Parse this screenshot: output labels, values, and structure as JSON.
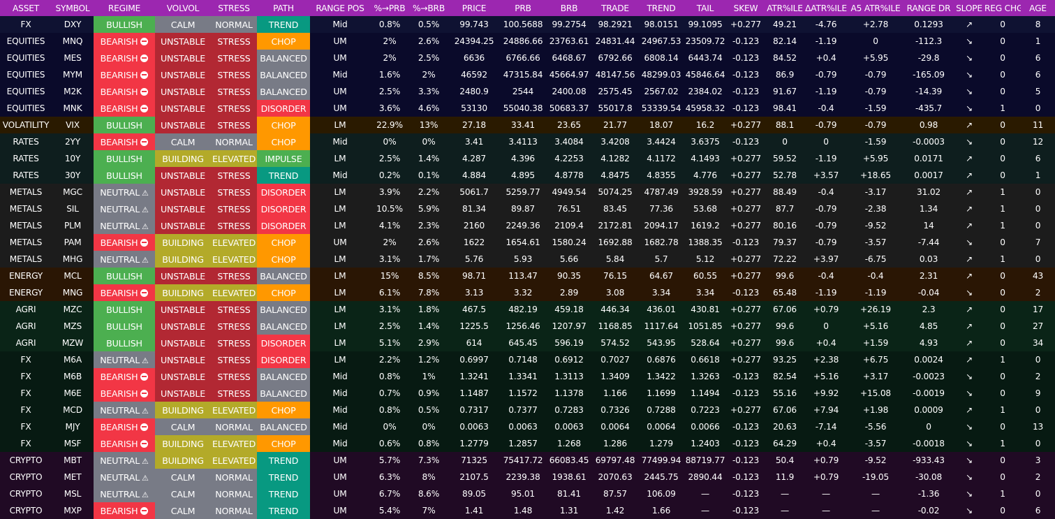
{
  "colors": {
    "header": "#9c27b0",
    "bullish": "#4caf50",
    "bearish": "#f23645",
    "neutral": "#787b86",
    "unstable_stress": "#b22833",
    "building_elevated": "#b3aa29",
    "trend": "#089981",
    "chop": "#ff9800",
    "disorder": "#f23645"
  },
  "columns": [
    "ASSET",
    "SYMBOL",
    "REGIME",
    "VOLVOL",
    "STRESS",
    "PATH",
    "RANGE POS",
    "%→PRB",
    "%→BRB",
    "PRICE",
    "PRB",
    "BRB",
    "TRADE",
    "TREND",
    "TAIL",
    "SKEW",
    "ATR%ILE",
    "ΔATR%ILE",
    "A5 ATR%ILE",
    "RANGE DR",
    "SLOPE",
    "REG CHG",
    "AGE"
  ],
  "rows": [
    {
      "asset": "FX",
      "symbol": "DXY",
      "regime": "BULLISH",
      "regime_icon": "",
      "volvol": "CALM",
      "stress": "NORMAL",
      "path": "TREND",
      "range_pos": "Mid",
      "pct_prb": "0.8%",
      "pct_brb": "0.5%",
      "price": "99.743",
      "prb": "100.5688",
      "brb": "99.2754",
      "trade": "98.2921",
      "trend": "98.0151",
      "tail": "99.1095",
      "skew": "+0.277",
      "atr_ile": "49.21",
      "d_atr_ile": "-4.76",
      "a5_atr_ile": "+2.78",
      "range_dr": "0.1293",
      "slope": "↗",
      "reg_chg": "0",
      "age": "8"
    },
    {
      "asset": "EQUITIES",
      "symbol": "MNQ",
      "regime": "BEARISH",
      "regime_icon": "stop-icon",
      "volvol": "UNSTABLE",
      "stress": "STRESS",
      "path": "CHOP",
      "range_pos": "UM",
      "pct_prb": "2%",
      "pct_brb": "2.6%",
      "price": "24394.25",
      "prb": "24886.66",
      "brb": "23763.61",
      "trade": "24831.44",
      "trend": "24967.53",
      "tail": "23509.72",
      "skew": "-0.123",
      "atr_ile": "82.14",
      "d_atr_ile": "-1.19",
      "a5_atr_ile": "0",
      "range_dr": "-112.3",
      "slope": "↘",
      "reg_chg": "0",
      "age": "1"
    },
    {
      "asset": "EQUITIES",
      "symbol": "MES",
      "regime": "BEARISH",
      "regime_icon": "stop-icon",
      "volvol": "UNSTABLE",
      "stress": "STRESS",
      "path": "BALANCED",
      "range_pos": "UM",
      "pct_prb": "2%",
      "pct_brb": "2.5%",
      "price": "6636",
      "prb": "6766.66",
      "brb": "6468.67",
      "trade": "6792.66",
      "trend": "6808.14",
      "tail": "6443.74",
      "skew": "-0.123",
      "atr_ile": "84.52",
      "d_atr_ile": "+0.4",
      "a5_atr_ile": "+5.95",
      "range_dr": "-29.8",
      "slope": "↘",
      "reg_chg": "0",
      "age": "6"
    },
    {
      "asset": "EQUITIES",
      "symbol": "MYM",
      "regime": "BEARISH",
      "regime_icon": "stop-icon",
      "volvol": "UNSTABLE",
      "stress": "STRESS",
      "path": "BALANCED",
      "range_pos": "Mid",
      "pct_prb": "1.6%",
      "pct_brb": "2%",
      "price": "46592",
      "prb": "47315.84",
      "brb": "45664.97",
      "trade": "48147.56",
      "trend": "48299.03",
      "tail": "45846.64",
      "skew": "-0.123",
      "atr_ile": "86.9",
      "d_atr_ile": "-0.79",
      "a5_atr_ile": "-0.79",
      "range_dr": "-165.09",
      "slope": "↘",
      "reg_chg": "0",
      "age": "6"
    },
    {
      "asset": "EQUITIES",
      "symbol": "M2K",
      "regime": "BEARISH",
      "regime_icon": "stop-icon",
      "volvol": "UNSTABLE",
      "stress": "STRESS",
      "path": "BALANCED",
      "range_pos": "UM",
      "pct_prb": "2.5%",
      "pct_brb": "3.3%",
      "price": "2480.9",
      "prb": "2544",
      "brb": "2400.08",
      "trade": "2575.45",
      "trend": "2567.02",
      "tail": "2384.02",
      "skew": "-0.123",
      "atr_ile": "91.67",
      "d_atr_ile": "-1.19",
      "a5_atr_ile": "-0.79",
      "range_dr": "-14.39",
      "slope": "↘",
      "reg_chg": "0",
      "age": "5"
    },
    {
      "asset": "EQUITIES",
      "symbol": "MNK",
      "regime": "BEARISH",
      "regime_icon": "stop-icon",
      "volvol": "UNSTABLE",
      "stress": "STRESS",
      "path": "DISORDER",
      "range_pos": "UM",
      "pct_prb": "3.6%",
      "pct_brb": "4.6%",
      "price": "53130",
      "prb": "55040.38",
      "brb": "50683.37",
      "trade": "55017.8",
      "trend": "53339.54",
      "tail": "45958.32",
      "skew": "-0.123",
      "atr_ile": "98.41",
      "d_atr_ile": "-0.4",
      "a5_atr_ile": "-1.59",
      "range_dr": "-435.7",
      "slope": "↘",
      "reg_chg": "1",
      "age": "0"
    },
    {
      "asset": "VOLATILITY",
      "symbol": "VIX",
      "regime": "BULLISH",
      "regime_icon": "",
      "volvol": "UNSTABLE",
      "stress": "STRESS",
      "path": "CHOP",
      "range_pos": "LM",
      "pct_prb": "22.9%",
      "pct_brb": "13%",
      "price": "27.18",
      "prb": "33.41",
      "brb": "23.65",
      "trade": "21.77",
      "trend": "18.07",
      "tail": "16.2",
      "skew": "+0.277",
      "atr_ile": "88.1",
      "d_atr_ile": "-0.79",
      "a5_atr_ile": "-0.79",
      "range_dr": "0.98",
      "slope": "↗",
      "reg_chg": "0",
      "age": "11"
    },
    {
      "asset": "RATES",
      "symbol": "2YY",
      "regime": "BEARISH",
      "regime_icon": "stop-icon",
      "volvol": "CALM",
      "stress": "NORMAL",
      "path": "CHOP",
      "range_pos": "Mid",
      "pct_prb": "0%",
      "pct_brb": "0%",
      "price": "3.41",
      "prb": "3.4113",
      "brb": "3.4084",
      "trade": "3.4208",
      "trend": "3.4424",
      "tail": "3.6375",
      "skew": "-0.123",
      "atr_ile": "0",
      "d_atr_ile": "0",
      "a5_atr_ile": "-1.59",
      "range_dr": "-0.0003",
      "slope": "↘",
      "reg_chg": "0",
      "age": "12"
    },
    {
      "asset": "RATES",
      "symbol": "10Y",
      "regime": "BULLISH",
      "regime_icon": "",
      "volvol": "BUILDING",
      "stress": "ELEVATED",
      "path": "IMPULSE",
      "range_pos": "LM",
      "pct_prb": "2.5%",
      "pct_brb": "1.4%",
      "price": "4.287",
      "prb": "4.396",
      "brb": "4.2253",
      "trade": "4.1282",
      "trend": "4.1172",
      "tail": "4.1493",
      "skew": "+0.277",
      "atr_ile": "59.52",
      "d_atr_ile": "-1.19",
      "a5_atr_ile": "+5.95",
      "range_dr": "0.0171",
      "slope": "↗",
      "reg_chg": "0",
      "age": "6"
    },
    {
      "asset": "RATES",
      "symbol": "30Y",
      "regime": "BULLISH",
      "regime_icon": "",
      "volvol": "UNSTABLE",
      "stress": "STRESS",
      "path": "TREND",
      "range_pos": "Mid",
      "pct_prb": "0.2%",
      "pct_brb": "0.1%",
      "price": "4.884",
      "prb": "4.895",
      "brb": "4.8778",
      "trade": "4.8475",
      "trend": "4.8355",
      "tail": "4.776",
      "skew": "+0.277",
      "atr_ile": "52.78",
      "d_atr_ile": "+3.57",
      "a5_atr_ile": "+18.65",
      "range_dr": "0.0017",
      "slope": "↗",
      "reg_chg": "0",
      "age": "1"
    },
    {
      "asset": "METALS",
      "symbol": "MGC",
      "regime": "NEUTRAL",
      "regime_icon": "warn-icon",
      "volvol": "UNSTABLE",
      "stress": "STRESS",
      "path": "DISORDER",
      "range_pos": "LM",
      "pct_prb": "3.9%",
      "pct_brb": "2.2%",
      "price": "5061.7",
      "prb": "5259.77",
      "brb": "4949.54",
      "trade": "5074.25",
      "trend": "4787.49",
      "tail": "3928.59",
      "skew": "+0.277",
      "atr_ile": "88.49",
      "d_atr_ile": "-0.4",
      "a5_atr_ile": "-3.17",
      "range_dr": "31.02",
      "slope": "↗",
      "reg_chg": "1",
      "age": "0"
    },
    {
      "asset": "METALS",
      "symbol": "SIL",
      "regime": "NEUTRAL",
      "regime_icon": "warn-icon",
      "volvol": "UNSTABLE",
      "stress": "STRESS",
      "path": "DISORDER",
      "range_pos": "LM",
      "pct_prb": "10.5%",
      "pct_brb": "5.9%",
      "price": "81.34",
      "prb": "89.87",
      "brb": "76.51",
      "trade": "83.45",
      "trend": "77.36",
      "tail": "53.68",
      "skew": "+0.277",
      "atr_ile": "87.7",
      "d_atr_ile": "-0.79",
      "a5_atr_ile": "-2.38",
      "range_dr": "1.34",
      "slope": "↗",
      "reg_chg": "1",
      "age": "0"
    },
    {
      "asset": "METALS",
      "symbol": "PLM",
      "regime": "NEUTRAL",
      "regime_icon": "warn-icon",
      "volvol": "UNSTABLE",
      "stress": "STRESS",
      "path": "DISORDER",
      "range_pos": "LM",
      "pct_prb": "4.1%",
      "pct_brb": "2.3%",
      "price": "2160",
      "prb": "2249.36",
      "brb": "2109.4",
      "trade": "2172.81",
      "trend": "2094.17",
      "tail": "1619.2",
      "skew": "+0.277",
      "atr_ile": "80.16",
      "d_atr_ile": "-0.79",
      "a5_atr_ile": "-9.52",
      "range_dr": "14",
      "slope": "↗",
      "reg_chg": "1",
      "age": "0"
    },
    {
      "asset": "METALS",
      "symbol": "PAM",
      "regime": "BEARISH",
      "regime_icon": "stop-icon",
      "volvol": "BUILDING",
      "stress": "ELEVATED",
      "path": "CHOP",
      "range_pos": "UM",
      "pct_prb": "2%",
      "pct_brb": "2.6%",
      "price": "1622",
      "prb": "1654.61",
      "brb": "1580.24",
      "trade": "1692.88",
      "trend": "1682.78",
      "tail": "1388.35",
      "skew": "-0.123",
      "atr_ile": "79.37",
      "d_atr_ile": "-0.79",
      "a5_atr_ile": "-3.57",
      "range_dr": "-7.44",
      "slope": "↘",
      "reg_chg": "0",
      "age": "7"
    },
    {
      "asset": "METALS",
      "symbol": "MHG",
      "regime": "NEUTRAL",
      "regime_icon": "warn-icon",
      "volvol": "BUILDING",
      "stress": "ELEVATED",
      "path": "CHOP",
      "range_pos": "LM",
      "pct_prb": "3.1%",
      "pct_brb": "1.7%",
      "price": "5.76",
      "prb": "5.93",
      "brb": "5.66",
      "trade": "5.84",
      "trend": "5.7",
      "tail": "5.12",
      "skew": "+0.277",
      "atr_ile": "72.22",
      "d_atr_ile": "+3.97",
      "a5_atr_ile": "-6.75",
      "range_dr": "0.03",
      "slope": "↗",
      "reg_chg": "1",
      "age": "0"
    },
    {
      "asset": "ENERGY",
      "symbol": "MCL",
      "regime": "BULLISH",
      "regime_icon": "",
      "volvol": "UNSTABLE",
      "stress": "STRESS",
      "path": "BALANCED",
      "range_pos": "LM",
      "pct_prb": "15%",
      "pct_brb": "8.5%",
      "price": "98.71",
      "prb": "113.47",
      "brb": "90.35",
      "trade": "76.15",
      "trend": "64.67",
      "tail": "60.55",
      "skew": "+0.277",
      "atr_ile": "99.6",
      "d_atr_ile": "-0.4",
      "a5_atr_ile": "-0.4",
      "range_dr": "2.31",
      "slope": "↗",
      "reg_chg": "0",
      "age": "43"
    },
    {
      "asset": "ENERGY",
      "symbol": "MNG",
      "regime": "BEARISH",
      "regime_icon": "stop-icon",
      "volvol": "BUILDING",
      "stress": "ELEVATED",
      "path": "CHOP",
      "range_pos": "LM",
      "pct_prb": "6.1%",
      "pct_brb": "7.8%",
      "price": "3.13",
      "prb": "3.32",
      "brb": "2.89",
      "trade": "3.08",
      "trend": "3.34",
      "tail": "3.34",
      "skew": "-0.123",
      "atr_ile": "65.48",
      "d_atr_ile": "-1.19",
      "a5_atr_ile": "-1.19",
      "range_dr": "-0.04",
      "slope": "↘",
      "reg_chg": "0",
      "age": "2"
    },
    {
      "asset": "AGRI",
      "symbol": "MZC",
      "regime": "BULLISH",
      "regime_icon": "",
      "volvol": "UNSTABLE",
      "stress": "STRESS",
      "path": "BALANCED",
      "range_pos": "LM",
      "pct_prb": "3.1%",
      "pct_brb": "1.8%",
      "price": "467.5",
      "prb": "482.19",
      "brb": "459.18",
      "trade": "446.34",
      "trend": "436.01",
      "tail": "430.81",
      "skew": "+0.277",
      "atr_ile": "67.06",
      "d_atr_ile": "+0.79",
      "a5_atr_ile": "+26.19",
      "range_dr": "2.3",
      "slope": "↗",
      "reg_chg": "0",
      "age": "17"
    },
    {
      "asset": "AGRI",
      "symbol": "MZS",
      "regime": "BULLISH",
      "regime_icon": "",
      "volvol": "UNSTABLE",
      "stress": "STRESS",
      "path": "BALANCED",
      "range_pos": "LM",
      "pct_prb": "2.5%",
      "pct_brb": "1.4%",
      "price": "1225.5",
      "prb": "1256.46",
      "brb": "1207.97",
      "trade": "1168.85",
      "trend": "1117.64",
      "tail": "1051.85",
      "skew": "+0.277",
      "atr_ile": "99.6",
      "d_atr_ile": "0",
      "a5_atr_ile": "+5.16",
      "range_dr": "4.85",
      "slope": "↗",
      "reg_chg": "0",
      "age": "27"
    },
    {
      "asset": "AGRI",
      "symbol": "MZW",
      "regime": "BULLISH",
      "regime_icon": "",
      "volvol": "UNSTABLE",
      "stress": "STRESS",
      "path": "DISORDER",
      "range_pos": "LM",
      "pct_prb": "5.1%",
      "pct_brb": "2.9%",
      "price": "614",
      "prb": "645.45",
      "brb": "596.19",
      "trade": "574.52",
      "trend": "543.95",
      "tail": "528.64",
      "skew": "+0.277",
      "atr_ile": "99.6",
      "d_atr_ile": "+0.4",
      "a5_atr_ile": "+1.59",
      "range_dr": "4.93",
      "slope": "↗",
      "reg_chg": "0",
      "age": "34"
    },
    {
      "asset": "FX",
      "symbol": "M6A",
      "regime": "NEUTRAL",
      "regime_icon": "warn-icon",
      "volvol": "UNSTABLE",
      "stress": "STRESS",
      "path": "DISORDER",
      "range_pos": "LM",
      "pct_prb": "2.2%",
      "pct_brb": "1.2%",
      "price": "0.6997",
      "prb": "0.7148",
      "brb": "0.6912",
      "trade": "0.7027",
      "trend": "0.6876",
      "tail": "0.6618",
      "skew": "+0.277",
      "atr_ile": "93.25",
      "d_atr_ile": "+2.38",
      "a5_atr_ile": "+6.75",
      "range_dr": "0.0024",
      "slope": "↗",
      "reg_chg": "1",
      "age": "0"
    },
    {
      "asset": "FX",
      "symbol": "M6B",
      "regime": "BEARISH",
      "regime_icon": "stop-icon",
      "volvol": "UNSTABLE",
      "stress": "STRESS",
      "path": "BALANCED",
      "range_pos": "Mid",
      "pct_prb": "0.8%",
      "pct_brb": "1%",
      "price": "1.3241",
      "prb": "1.3341",
      "brb": "1.3113",
      "trade": "1.3409",
      "trend": "1.3422",
      "tail": "1.3263",
      "skew": "-0.123",
      "atr_ile": "82.54",
      "d_atr_ile": "+5.16",
      "a5_atr_ile": "+3.17",
      "range_dr": "-0.0023",
      "slope": "↘",
      "reg_chg": "0",
      "age": "2"
    },
    {
      "asset": "FX",
      "symbol": "M6E",
      "regime": "BEARISH",
      "regime_icon": "stop-icon",
      "volvol": "UNSTABLE",
      "stress": "STRESS",
      "path": "BALANCED",
      "range_pos": "Mid",
      "pct_prb": "0.7%",
      "pct_brb": "0.9%",
      "price": "1.1487",
      "prb": "1.1572",
      "brb": "1.1378",
      "trade": "1.166",
      "trend": "1.1699",
      "tail": "1.1494",
      "skew": "-0.123",
      "atr_ile": "55.16",
      "d_atr_ile": "+9.92",
      "a5_atr_ile": "+15.08",
      "range_dr": "-0.0019",
      "slope": "↘",
      "reg_chg": "0",
      "age": "9"
    },
    {
      "asset": "FX",
      "symbol": "MCD",
      "regime": "NEUTRAL",
      "regime_icon": "warn-icon",
      "volvol": "BUILDING",
      "stress": "ELEVATED",
      "path": "CHOP",
      "range_pos": "Mid",
      "pct_prb": "0.8%",
      "pct_brb": "0.5%",
      "price": "0.7317",
      "prb": "0.7377",
      "brb": "0.7283",
      "trade": "0.7326",
      "trend": "0.7288",
      "tail": "0.7223",
      "skew": "+0.277",
      "atr_ile": "67.06",
      "d_atr_ile": "+7.94",
      "a5_atr_ile": "+1.98",
      "range_dr": "0.0009",
      "slope": "↗",
      "reg_chg": "1",
      "age": "0"
    },
    {
      "asset": "FX",
      "symbol": "MJY",
      "regime": "BEARISH",
      "regime_icon": "stop-icon",
      "volvol": "CALM",
      "stress": "NORMAL",
      "path": "BALANCED",
      "range_pos": "Mid",
      "pct_prb": "0%",
      "pct_brb": "0%",
      "price": "0.0063",
      "prb": "0.0063",
      "brb": "0.0063",
      "trade": "0.0064",
      "trend": "0.0064",
      "tail": "0.0066",
      "skew": "-0.123",
      "atr_ile": "20.63",
      "d_atr_ile": "-7.14",
      "a5_atr_ile": "-5.56",
      "range_dr": "0",
      "slope": "↘",
      "reg_chg": "0",
      "age": "13"
    },
    {
      "asset": "FX",
      "symbol": "MSF",
      "regime": "BEARISH",
      "regime_icon": "stop-icon",
      "volvol": "BUILDING",
      "stress": "ELEVATED",
      "path": "CHOP",
      "range_pos": "Mid",
      "pct_prb": "0.6%",
      "pct_brb": "0.8%",
      "price": "1.2779",
      "prb": "1.2857",
      "brb": "1.268",
      "trade": "1.286",
      "trend": "1.279",
      "tail": "1.2403",
      "skew": "-0.123",
      "atr_ile": "64.29",
      "d_atr_ile": "+0.4",
      "a5_atr_ile": "-3.57",
      "range_dr": "-0.0018",
      "slope": "↘",
      "reg_chg": "1",
      "age": "0"
    },
    {
      "asset": "CRYPTO",
      "symbol": "MBT",
      "regime": "NEUTRAL",
      "regime_icon": "warn-icon",
      "volvol": "BUILDING",
      "stress": "ELEVATED",
      "path": "TREND",
      "range_pos": "UM",
      "pct_prb": "5.7%",
      "pct_brb": "7.3%",
      "price": "71325",
      "prb": "75417.72",
      "brb": "66083.45",
      "trade": "69797.48",
      "trend": "77499.94",
      "tail": "88719.77",
      "skew": "-0.123",
      "atr_ile": "50.4",
      "d_atr_ile": "+0.79",
      "a5_atr_ile": "-9.52",
      "range_dr": "-933.43",
      "slope": "↘",
      "reg_chg": "0",
      "age": "3"
    },
    {
      "asset": "CRYPTO",
      "symbol": "MET",
      "regime": "NEUTRAL",
      "regime_icon": "warn-icon",
      "volvol": "CALM",
      "stress": "NORMAL",
      "path": "TREND",
      "range_pos": "UM",
      "pct_prb": "6.3%",
      "pct_brb": "8%",
      "price": "2107.5",
      "prb": "2239.38",
      "brb": "1938.61",
      "trade": "2070.63",
      "trend": "2445.75",
      "tail": "2890.44",
      "skew": "-0.123",
      "atr_ile": "11.9",
      "d_atr_ile": "+0.79",
      "a5_atr_ile": "-19.05",
      "range_dr": "-30.08",
      "slope": "↘",
      "reg_chg": "0",
      "age": "2"
    },
    {
      "asset": "CRYPTO",
      "symbol": "MSL",
      "regime": "NEUTRAL",
      "regime_icon": "warn-icon",
      "volvol": "CALM",
      "stress": "NORMAL",
      "path": "TREND",
      "range_pos": "UM",
      "pct_prb": "6.7%",
      "pct_brb": "8.6%",
      "price": "89.05",
      "prb": "95.01",
      "brb": "81.41",
      "trade": "87.57",
      "trend": "106.09",
      "tail": "—",
      "skew": "-0.123",
      "atr_ile": "—",
      "d_atr_ile": "—",
      "a5_atr_ile": "—",
      "range_dr": "-1.36",
      "slope": "↘",
      "reg_chg": "1",
      "age": "0"
    },
    {
      "asset": "CRYPTO",
      "symbol": "MXP",
      "regime": "BEARISH",
      "regime_icon": "stop-icon",
      "volvol": "CALM",
      "stress": "NORMAL",
      "path": "TREND",
      "range_pos": "UM",
      "pct_prb": "5.4%",
      "pct_brb": "7%",
      "price": "1.41",
      "prb": "1.48",
      "brb": "1.31",
      "trade": "1.42",
      "trend": "1.66",
      "tail": "—",
      "skew": "-0.123",
      "atr_ile": "—",
      "d_atr_ile": "—",
      "a5_atr_ile": "—",
      "range_dr": "-0.02",
      "slope": "↘",
      "reg_chg": "0",
      "age": "6"
    }
  ]
}
